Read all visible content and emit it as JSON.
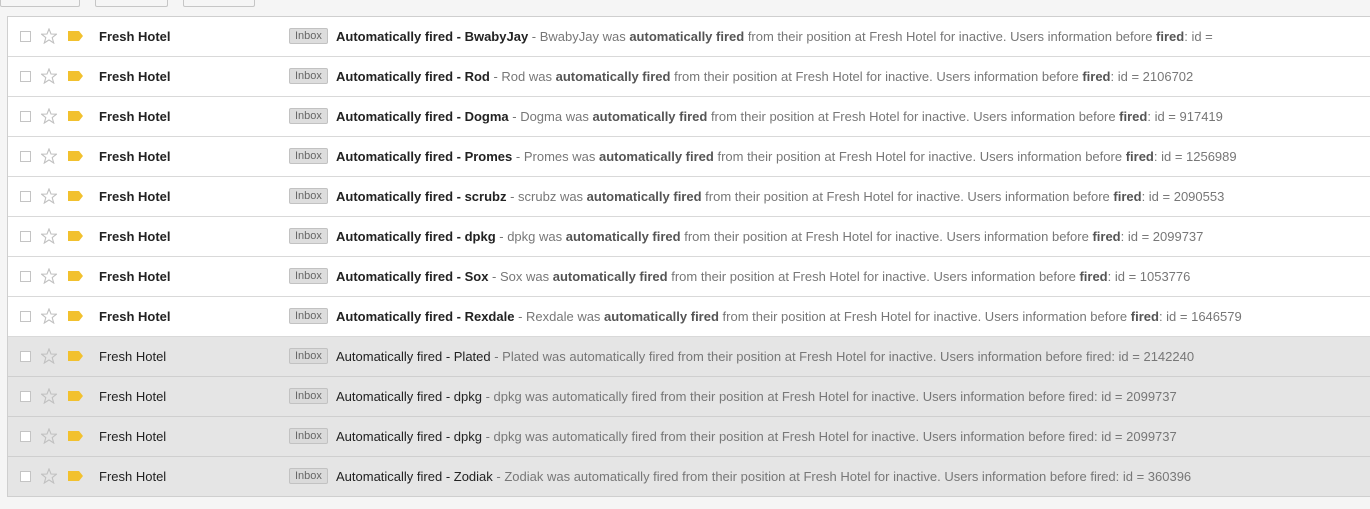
{
  "label_text": "Inbox",
  "emails": [
    {
      "read": false,
      "sender": "Fresh Hotel",
      "subject": "Automatically fired - BwabyJay",
      "snippet": [
        " - BwabyJay was ",
        "automatically fired",
        " from their position at Fresh Hotel for inactive. Users information before ",
        "fired",
        ": id ="
      ]
    },
    {
      "read": false,
      "sender": "Fresh Hotel",
      "subject": "Automatically fired - Rod",
      "snippet": [
        " - Rod was ",
        "automatically fired",
        " from their position at Fresh Hotel for inactive. Users information before ",
        "fired",
        ": id = 2106702"
      ]
    },
    {
      "read": false,
      "sender": "Fresh Hotel",
      "subject": "Automatically fired - Dogma",
      "snippet": [
        " - Dogma was ",
        "automatically fired",
        " from their position at Fresh Hotel for inactive. Users information before ",
        "fired",
        ": id = 917419"
      ]
    },
    {
      "read": false,
      "sender": "Fresh Hotel",
      "subject": "Automatically fired - Promes",
      "snippet": [
        " - Promes was ",
        "automatically fired",
        " from their position at Fresh Hotel for inactive. Users information before ",
        "fired",
        ": id = 1256989"
      ]
    },
    {
      "read": false,
      "sender": "Fresh Hotel",
      "subject": "Automatically fired - scrubz",
      "snippet": [
        " - scrubz was ",
        "automatically fired",
        " from their position at Fresh Hotel for inactive. Users information before ",
        "fired",
        ": id = 2090553"
      ]
    },
    {
      "read": false,
      "sender": "Fresh Hotel",
      "subject": "Automatically fired - dpkg",
      "snippet": [
        " - dpkg was ",
        "automatically fired",
        " from their position at Fresh Hotel for inactive. Users information before ",
        "fired",
        ": id = 2099737"
      ]
    },
    {
      "read": false,
      "sender": "Fresh Hotel",
      "subject": "Automatically fired - Sox",
      "snippet": [
        " - Sox was ",
        "automatically fired",
        " from their position at Fresh Hotel for inactive. Users information before ",
        "fired",
        ": id = 1053776"
      ]
    },
    {
      "read": false,
      "sender": "Fresh Hotel",
      "subject": "Automatically fired - Rexdale",
      "snippet": [
        " - Rexdale was ",
        "automatically fired",
        " from their position at Fresh Hotel for inactive. Users information before ",
        "fired",
        ": id = 1646579"
      ]
    },
    {
      "read": true,
      "sender": "Fresh Hotel",
      "subject": "Automatically fired - Plated",
      "snippet": [
        " - Plated was ",
        "automatically fired",
        " from their position at Fresh Hotel for inactive. Users information before ",
        "fired",
        ": id = 2142240"
      ]
    },
    {
      "read": true,
      "sender": "Fresh Hotel",
      "subject": "Automatically fired - dpkg",
      "snippet": [
        " - dpkg was ",
        "automatically fired",
        " from their position at Fresh Hotel for inactive. Users information before ",
        "fired",
        ": id = 2099737"
      ]
    },
    {
      "read": true,
      "sender": "Fresh Hotel",
      "subject": "Automatically fired - dpkg",
      "snippet": [
        " - dpkg was ",
        "automatically fired",
        " from their position at Fresh Hotel for inactive. Users information before ",
        "fired",
        ": id = 2099737"
      ]
    },
    {
      "read": true,
      "sender": "Fresh Hotel",
      "subject": "Automatically fired - Zodiak",
      "snippet": [
        " - Zodiak was ",
        "automatically fired",
        " from their position at Fresh Hotel for inactive. Users information before ",
        "fired",
        ": id = 360396"
      ]
    }
  ],
  "colors": {
    "tag": "#f2c12e",
    "star": "#c0c0c0",
    "read_row": "#e5e5e5",
    "unread_row": "#ffffff"
  },
  "icons": {
    "star": "star-icon",
    "tag": "importance-marker-icon",
    "checkbox": "checkbox"
  }
}
